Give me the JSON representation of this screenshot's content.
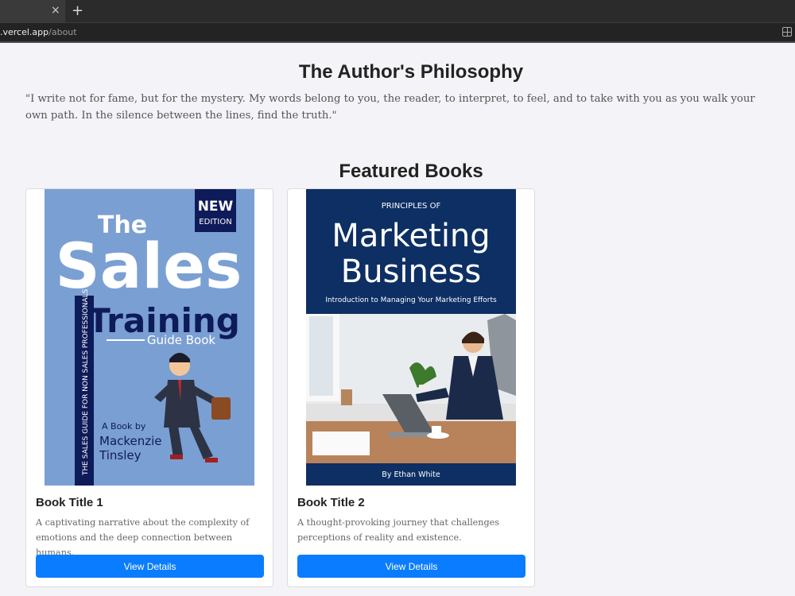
{
  "browser": {
    "url_host": ".vercel.app",
    "url_path": "/about",
    "tab_close_glyph": "×",
    "new_tab_glyph": "+"
  },
  "philosophy": {
    "title": "The Author's Philosophy",
    "quote": "\"I write not for fame, but for the mystery. My words belong to you, the reader, to interpret, to feel, and to take with you as you walk your own path. In the silence between the lines, find the truth.\""
  },
  "featured": {
    "title": "Featured Books",
    "books": [
      {
        "title": "Book Title 1",
        "description": "A captivating narrative about the complexity of emotions and the deep connection between humans.",
        "button_label": "View Details",
        "cover": {
          "top_word": "The",
          "big_word": "Sales",
          "word2": "Training",
          "word3": "Guide Book",
          "badge_line1": "NEW",
          "badge_line2": "EDITION",
          "spine_text": "THE SALES GUIDE FOR NON SALES PROFESSIONALS",
          "by_line": "A Book by",
          "author_line1": "Mackenzie",
          "author_line2": "Tinsley",
          "bg_color": "#7a9fd3",
          "accent_color": "#0e1b5a"
        }
      },
      {
        "title": "Book Title 2",
        "description": "A thought-provoking journey that challenges perceptions of reality and existence.",
        "button_label": "View Details",
        "cover": {
          "kicker": "PRINCIPLES OF",
          "line1": "Marketing",
          "line2": "Business",
          "subtitle": "Introduction to Managing Your Marketing Efforts",
          "author": "By Ethan White",
          "bg_color": "#0d2f63"
        }
      }
    ]
  },
  "colors": {
    "button_blue": "#0a7cff",
    "page_bg": "#f4f4f8"
  }
}
